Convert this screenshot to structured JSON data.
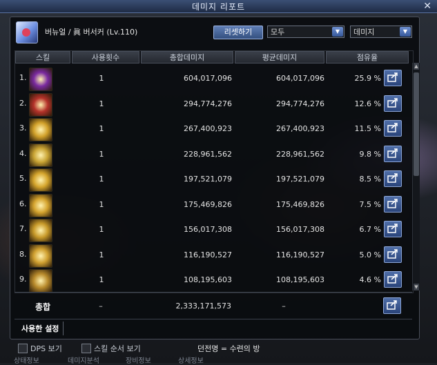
{
  "window": {
    "title": "데미지 리포트",
    "close_glyph": "✕"
  },
  "header": {
    "character": "버뉴얼 / 眞 버서커 (Lv.110)",
    "reset_label": "리셋하기",
    "filter_all": "모두",
    "filter_type": "데미지"
  },
  "columns": [
    "스킬",
    "사용횟수",
    "총합데미지",
    "평균데미지",
    "점유율"
  ],
  "rows": [
    {
      "index": "1.",
      "count": "1",
      "total": "604,017,096",
      "average": "604,017,096",
      "share": "25.9 %",
      "icon_color": "#7a2aa0"
    },
    {
      "index": "2.",
      "count": "1",
      "total": "294,774,276",
      "average": "294,774,276",
      "share": "12.6 %",
      "icon_color": "#b4322a"
    },
    {
      "index": "3.",
      "count": "1",
      "total": "267,400,923",
      "average": "267,400,923",
      "share": "11.5 %",
      "icon_color": "#d2a12a"
    },
    {
      "index": "4.",
      "count": "1",
      "total": "228,961,562",
      "average": "228,961,562",
      "share": "9.8 %",
      "icon_color": "#c9a434"
    },
    {
      "index": "5.",
      "count": "1",
      "total": "197,521,079",
      "average": "197,521,079",
      "share": "8.5 %",
      "icon_color": "#d5a52c"
    },
    {
      "index": "6.",
      "count": "1",
      "total": "175,469,826",
      "average": "175,469,826",
      "share": "7.5 %",
      "icon_color": "#d4a32e"
    },
    {
      "index": "7.",
      "count": "1",
      "total": "156,017,308",
      "average": "156,017,308",
      "share": "6.7 %",
      "icon_color": "#c89a2a"
    },
    {
      "index": "8.",
      "count": "1",
      "total": "116,190,527",
      "average": "116,190,527",
      "share": "5.0 %",
      "icon_color": "#d0a030"
    },
    {
      "index": "9.",
      "count": "1",
      "total": "108,195,603",
      "average": "108,195,603",
      "share": "4.6 %",
      "icon_color": "#b98b2c"
    }
  ],
  "total": {
    "label": "총합",
    "count": "–",
    "total": "2,333,171,573",
    "average": "–"
  },
  "tabs": {
    "used_settings": "사용한 설정"
  },
  "footer": {
    "dps_label": "DPS 보기",
    "skill_order_label": "스킬 순서 보기",
    "dungeon_text": "던전명 = 수련의 방",
    "faded_items": [
      "상태정보",
      "데미지분석",
      "장비정보",
      "상세정보"
    ]
  },
  "colors": {
    "accent": "#4f6ea8",
    "frame_bg": "#0a0c0f"
  }
}
